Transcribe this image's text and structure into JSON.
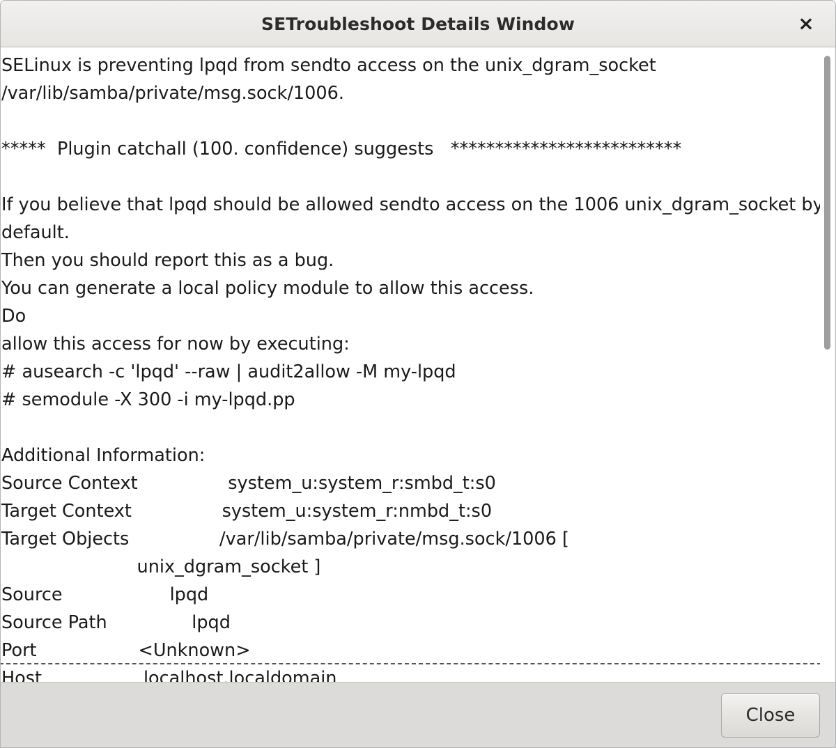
{
  "window": {
    "title": "SETroubleshoot Details Window",
    "close_icon": "close-x-icon",
    "close_glyph": "×"
  },
  "body_lines": [
    {
      "id": "alert-summary",
      "text": "SELinux is preventing lpqd from sendto access on the unix_dgram_socket /var/lib/samba/private/msg.sock/1006.",
      "wrap": true
    },
    {
      "id": "spacer-1",
      "text": " ",
      "wrap": false
    },
    {
      "id": "plugin-header",
      "text": "*****  Plugin catchall (100. confidence) suggests   **************************",
      "wrap": false
    },
    {
      "id": "spacer-2",
      "text": " ",
      "wrap": false
    },
    {
      "id": "suggestion-belief",
      "text": "If you believe that lpqd should be allowed sendto access on the 1006 unix_dgram_socket by default.",
      "wrap": true
    },
    {
      "id": "suggestion-bug",
      "text": "Then you should report this as a bug.",
      "wrap": false
    },
    {
      "id": "suggestion-module",
      "text": "You can generate a local policy module to allow this access.",
      "wrap": false
    },
    {
      "id": "suggestion-do",
      "text": "Do",
      "wrap": false
    },
    {
      "id": "suggestion-allow",
      "text": "allow this access for now by executing:",
      "wrap": false
    },
    {
      "id": "command-ausearch",
      "text": "# ausearch -c 'lpqd' --raw | audit2allow -M my-lpqd",
      "wrap": false
    },
    {
      "id": "command-semodule",
      "text": "# semodule -X 300 -i my-lpqd.pp",
      "wrap": false
    },
    {
      "id": "spacer-3",
      "text": " ",
      "wrap": false
    },
    {
      "id": "additional-info-heading",
      "text": "Additional Information:",
      "wrap": false
    },
    {
      "id": "row-source-context",
      "text": "Source Context                system_u:system_r:smbd_t:s0",
      "wrap": false
    },
    {
      "id": "row-target-context",
      "text": "Target Context                system_u:system_r:nmbd_t:s0",
      "wrap": false
    },
    {
      "id": "row-target-objects",
      "text": "Target Objects                /var/lib/samba/private/msg.sock/1006 [",
      "wrap": false
    },
    {
      "id": "row-target-objects-cont",
      "text": "                        unix_dgram_socket ]",
      "wrap": false
    },
    {
      "id": "row-source",
      "text": "Source                   lpqd",
      "wrap": false
    },
    {
      "id": "row-source-path",
      "text": "Source Path               lpqd",
      "wrap": false
    },
    {
      "id": "row-port",
      "text": "Port                  <Unknown>",
      "wrap": false
    },
    {
      "id": "row-host",
      "text": "Host                  localhost.localdomain",
      "wrap": false,
      "focused": true
    }
  ],
  "scrollbar": {
    "name": "vertical-scrollbar",
    "thumb_name": "vertical-scrollbar-thumb"
  },
  "footer": {
    "close_button_label": "Close"
  },
  "colors": {
    "titlebar_bg": "#eceae8",
    "footer_bg": "#dcdbd9",
    "text": "#1a1a1a",
    "scrollbar_thumb": "#9e9e9e",
    "window_border": "#b4b4b4"
  }
}
